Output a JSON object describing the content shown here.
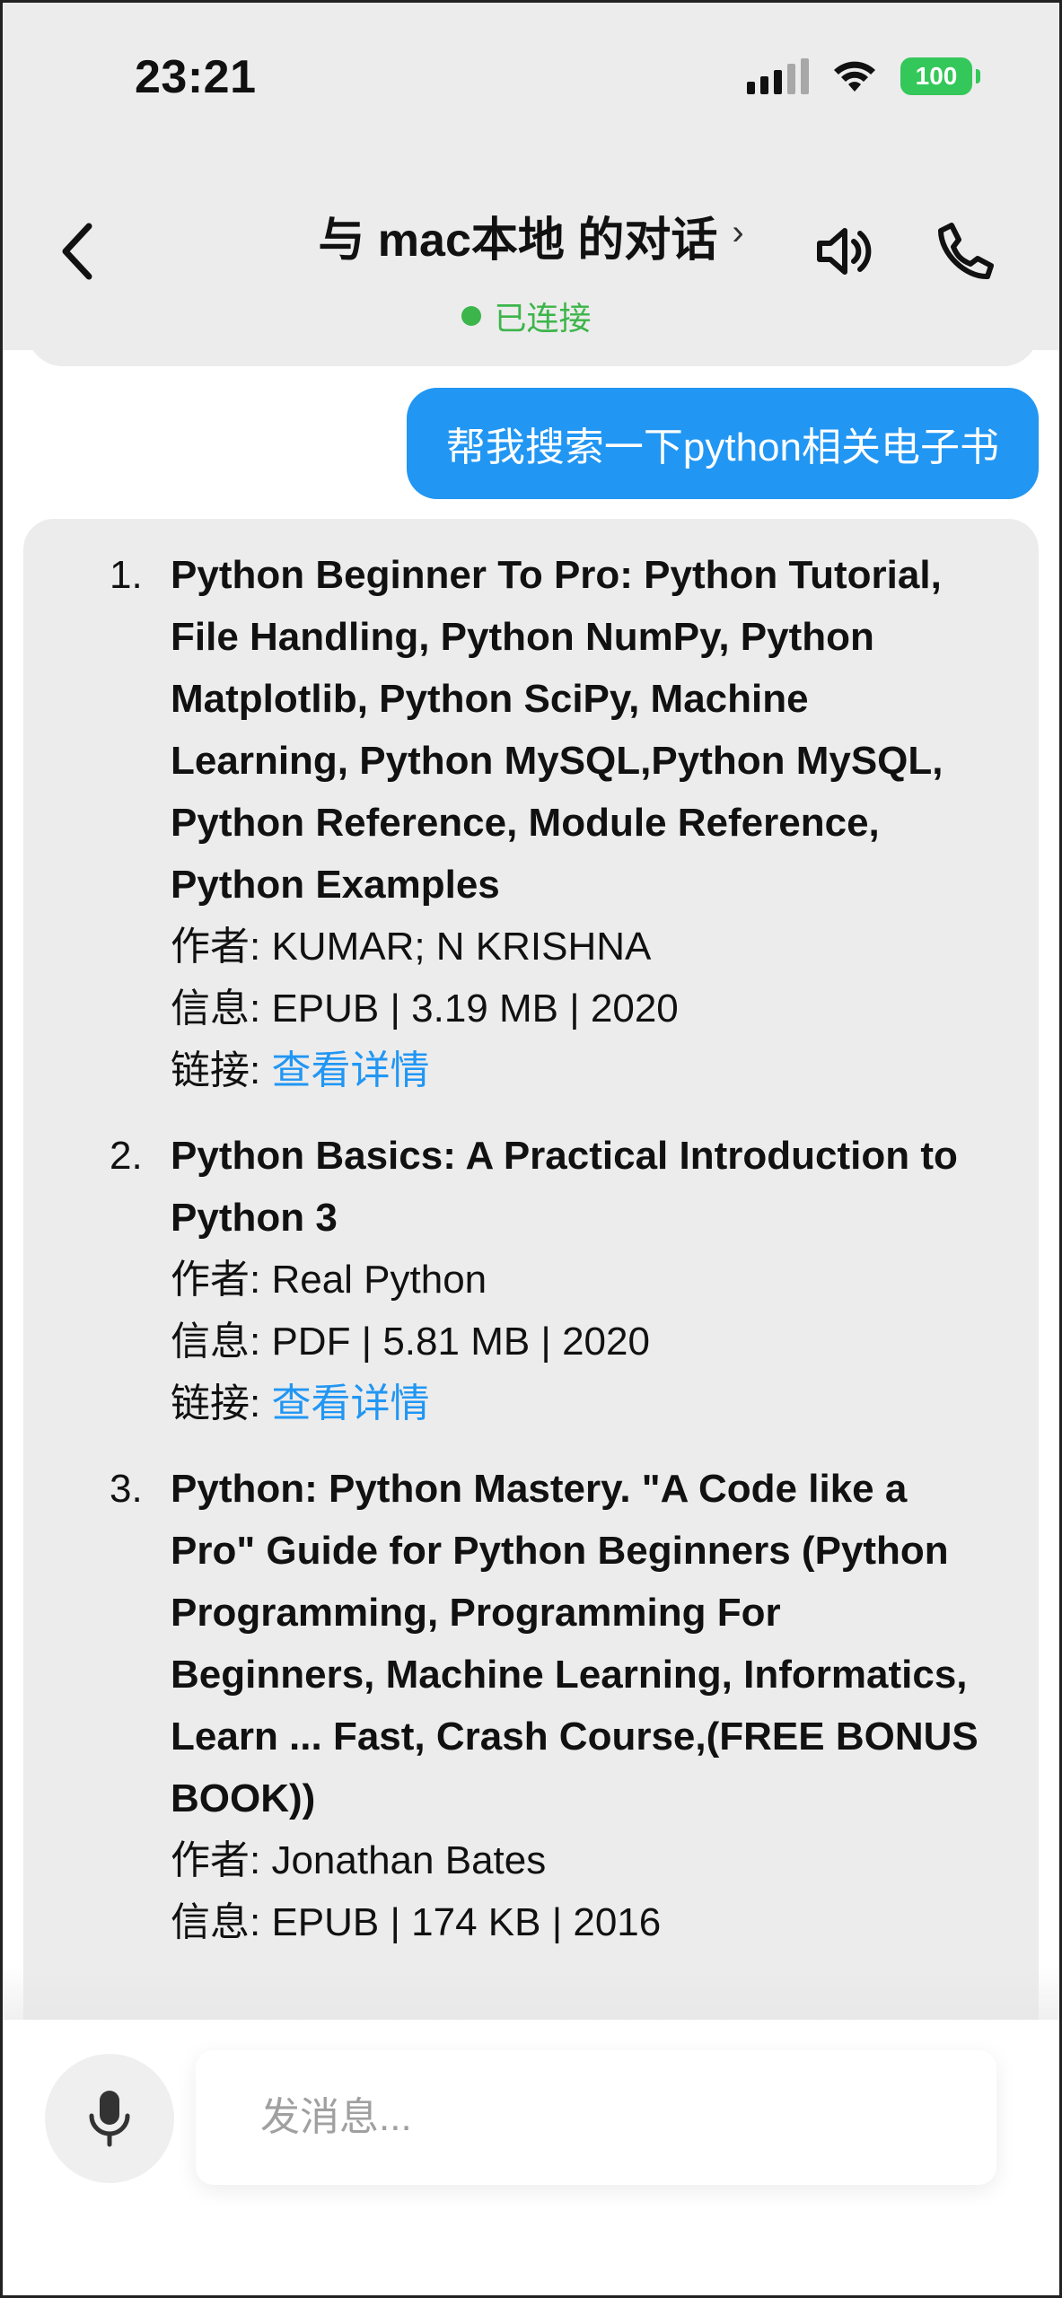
{
  "status_bar": {
    "time": "23:21",
    "battery": "100",
    "icons": [
      "cellular-signal-icon",
      "wifi-icon",
      "battery-icon"
    ]
  },
  "header": {
    "title": "与 mac本地 的对话",
    "title_chevron": "›",
    "connection_status": "已连接",
    "connection_color": "#3cb54a",
    "icons": [
      "back-chevron-icon",
      "speaker-icon",
      "phone-icon"
    ]
  },
  "user_message": "帮我搜索一下python相关电子书",
  "books": [
    {
      "number": "1.",
      "title": "Python Beginner To Pro: Python Tutorial, File Handling, Python NumPy, Python Matplotlib, Python SciPy, Machine Learning, Python MySQL,Python MySQL, Python Reference, Module Reference, Python Examples",
      "author_line": "作者: KUMAR; N KRISHNA",
      "info_line": "信息: EPUB | 3.19 MB | 2020",
      "link_label": "链接: ",
      "link_text": "查看详情"
    },
    {
      "number": "2.",
      "title": "Python Basics: A Practical Introduction to Python 3",
      "author_line": "作者: Real Python",
      "info_line": "信息: PDF | 5.81 MB | 2020",
      "link_label": "链接: ",
      "link_text": "查看详情"
    },
    {
      "number": "3.",
      "title": "Python: Python Mastery. \"A Code like a Pro\" Guide for Python Beginners (Python Programming, Programming For Beginners, Machine Learning, Informatics, Learn ... Fast, Crash Course,(FREE BONUS BOOK))",
      "author_line": "作者: Jonathan Bates",
      "info_line": "信息: EPUB | 174 KB | 2016"
    }
  ],
  "input": {
    "placeholder": "发消息..."
  },
  "colors": {
    "accent": "#2196f3",
    "bubble_bg": "#ececec",
    "header_bg": "#ececec"
  }
}
